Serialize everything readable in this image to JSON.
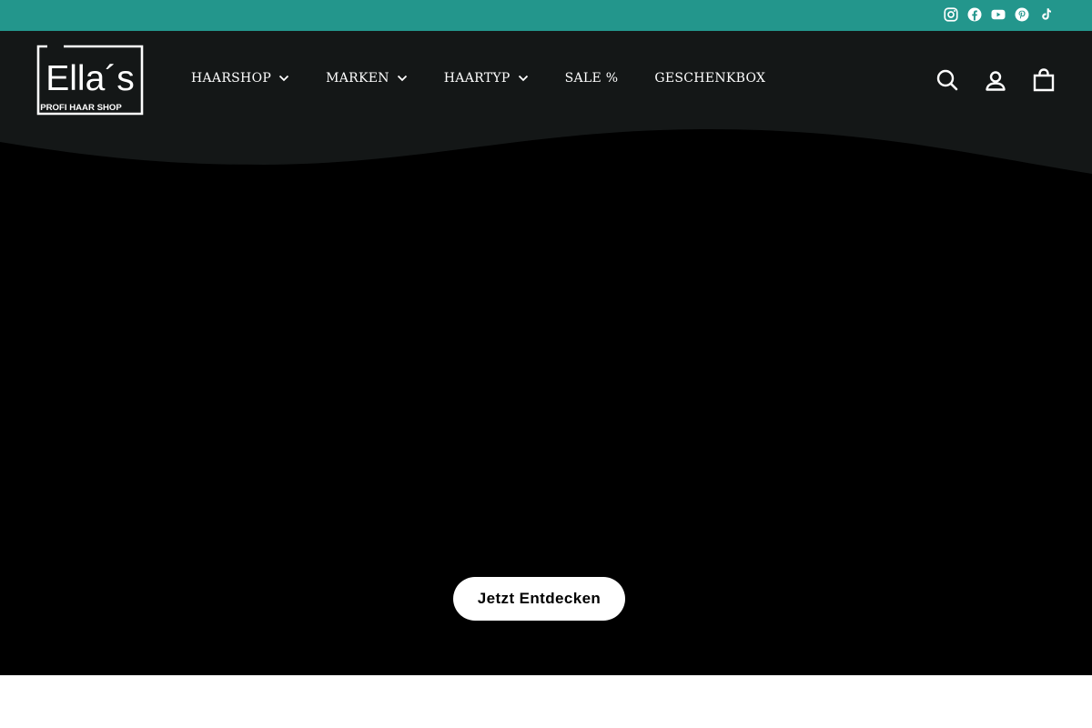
{
  "colors": {
    "accent": "#23968c",
    "header_bg": "#141717",
    "hero_bg": "#000000",
    "button_bg": "#ffffff"
  },
  "social_icons": [
    "instagram-icon",
    "facebook-icon",
    "youtube-icon",
    "pinterest-icon",
    "tiktok-icon"
  ],
  "logo": {
    "wordmark": "Ella´s",
    "tagline": "PROFI HAAR SHOP"
  },
  "nav": {
    "items": [
      {
        "label": "HAARSHOP",
        "has_dropdown": true
      },
      {
        "label": "MARKEN",
        "has_dropdown": true
      },
      {
        "label": "HAARTYP",
        "has_dropdown": true
      },
      {
        "label": "SALE %",
        "has_dropdown": false
      },
      {
        "label": "GESCHENKBOX",
        "has_dropdown": false
      }
    ]
  },
  "header_icons": [
    "search-icon",
    "account-icon",
    "cart-icon"
  ],
  "hero": {
    "cta_label": "Jetzt Entdecken"
  }
}
